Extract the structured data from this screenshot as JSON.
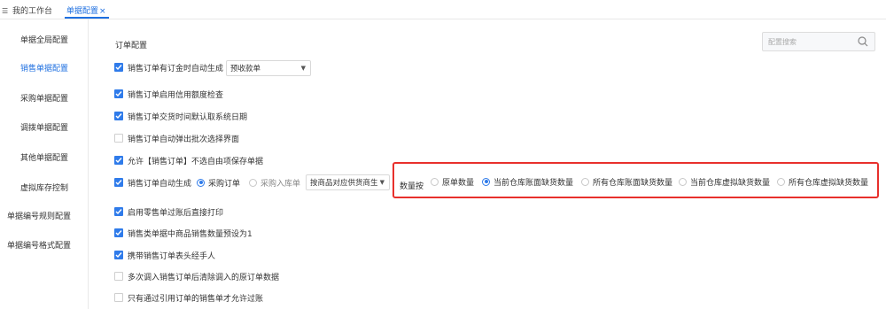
{
  "tabs": {
    "home_label": "我的工作台",
    "active_label": "单据配置",
    "close_glyph": "×"
  },
  "sidebar": {
    "items": [
      {
        "label": "单据全局配置"
      },
      {
        "label": "销售单据配置"
      },
      {
        "label": "采购单据配置"
      },
      {
        "label": "调拨单据配置"
      },
      {
        "label": "其他单据配置"
      },
      {
        "label": "虚拟库存控制"
      },
      {
        "label": "单据编号规则配置"
      },
      {
        "label": "单据编号格式配置"
      }
    ],
    "active_index": 1
  },
  "main": {
    "section_title": "订单配置",
    "search_placeholder": "配置搜索",
    "options": [
      {
        "label": "销售订单有订金时自动生成",
        "checked": true
      },
      {
        "label": "销售订单启用信用额度检查",
        "checked": true
      },
      {
        "label": "销售订单交货时间默认取系统日期",
        "checked": true
      },
      {
        "label": "销售订单自动弹出批次选择界面",
        "checked": false
      },
      {
        "label": "允许【销售订单】不选自由项保存单据",
        "checked": true
      },
      {
        "label": "销售订单自动生成",
        "checked": true
      },
      {
        "label": "启用零售单过账后直接打印",
        "checked": true
      },
      {
        "label": "销售类单据中商品销售数量预设为1",
        "checked": true
      },
      {
        "label": "携带销售订单表头经手人",
        "checked": true
      },
      {
        "label": "多次调入销售订单后清除调入的原订单数据",
        "checked": false
      },
      {
        "label": "只有通过引用订单的销售单才允许过账",
        "checked": false
      }
    ],
    "deposit_select_value": "预收款单",
    "autogen_radios": [
      {
        "label": "采购订单",
        "selected": true
      },
      {
        "label": "采购入库单",
        "selected": false
      }
    ],
    "supplier_select_value": "按商品对应供货商生",
    "qty_label": "数量按",
    "qty_radios": [
      {
        "label": "原单数量",
        "selected": false
      },
      {
        "label": "当前仓库账面缺货数量",
        "selected": true
      },
      {
        "label": "所有仓库账面缺货数量",
        "selected": false
      },
      {
        "label": "当前仓库虚拟缺货数量",
        "selected": false
      },
      {
        "label": "所有仓库虚拟缺货数量",
        "selected": false
      }
    ]
  },
  "colors": {
    "accent": "#1e6fe0",
    "checkbox": "#2f7bea",
    "highlight_box": "#e8302c"
  },
  "icons": {
    "home": "list-icon",
    "search": "search-icon",
    "dropdown": "chevron-down-icon"
  }
}
